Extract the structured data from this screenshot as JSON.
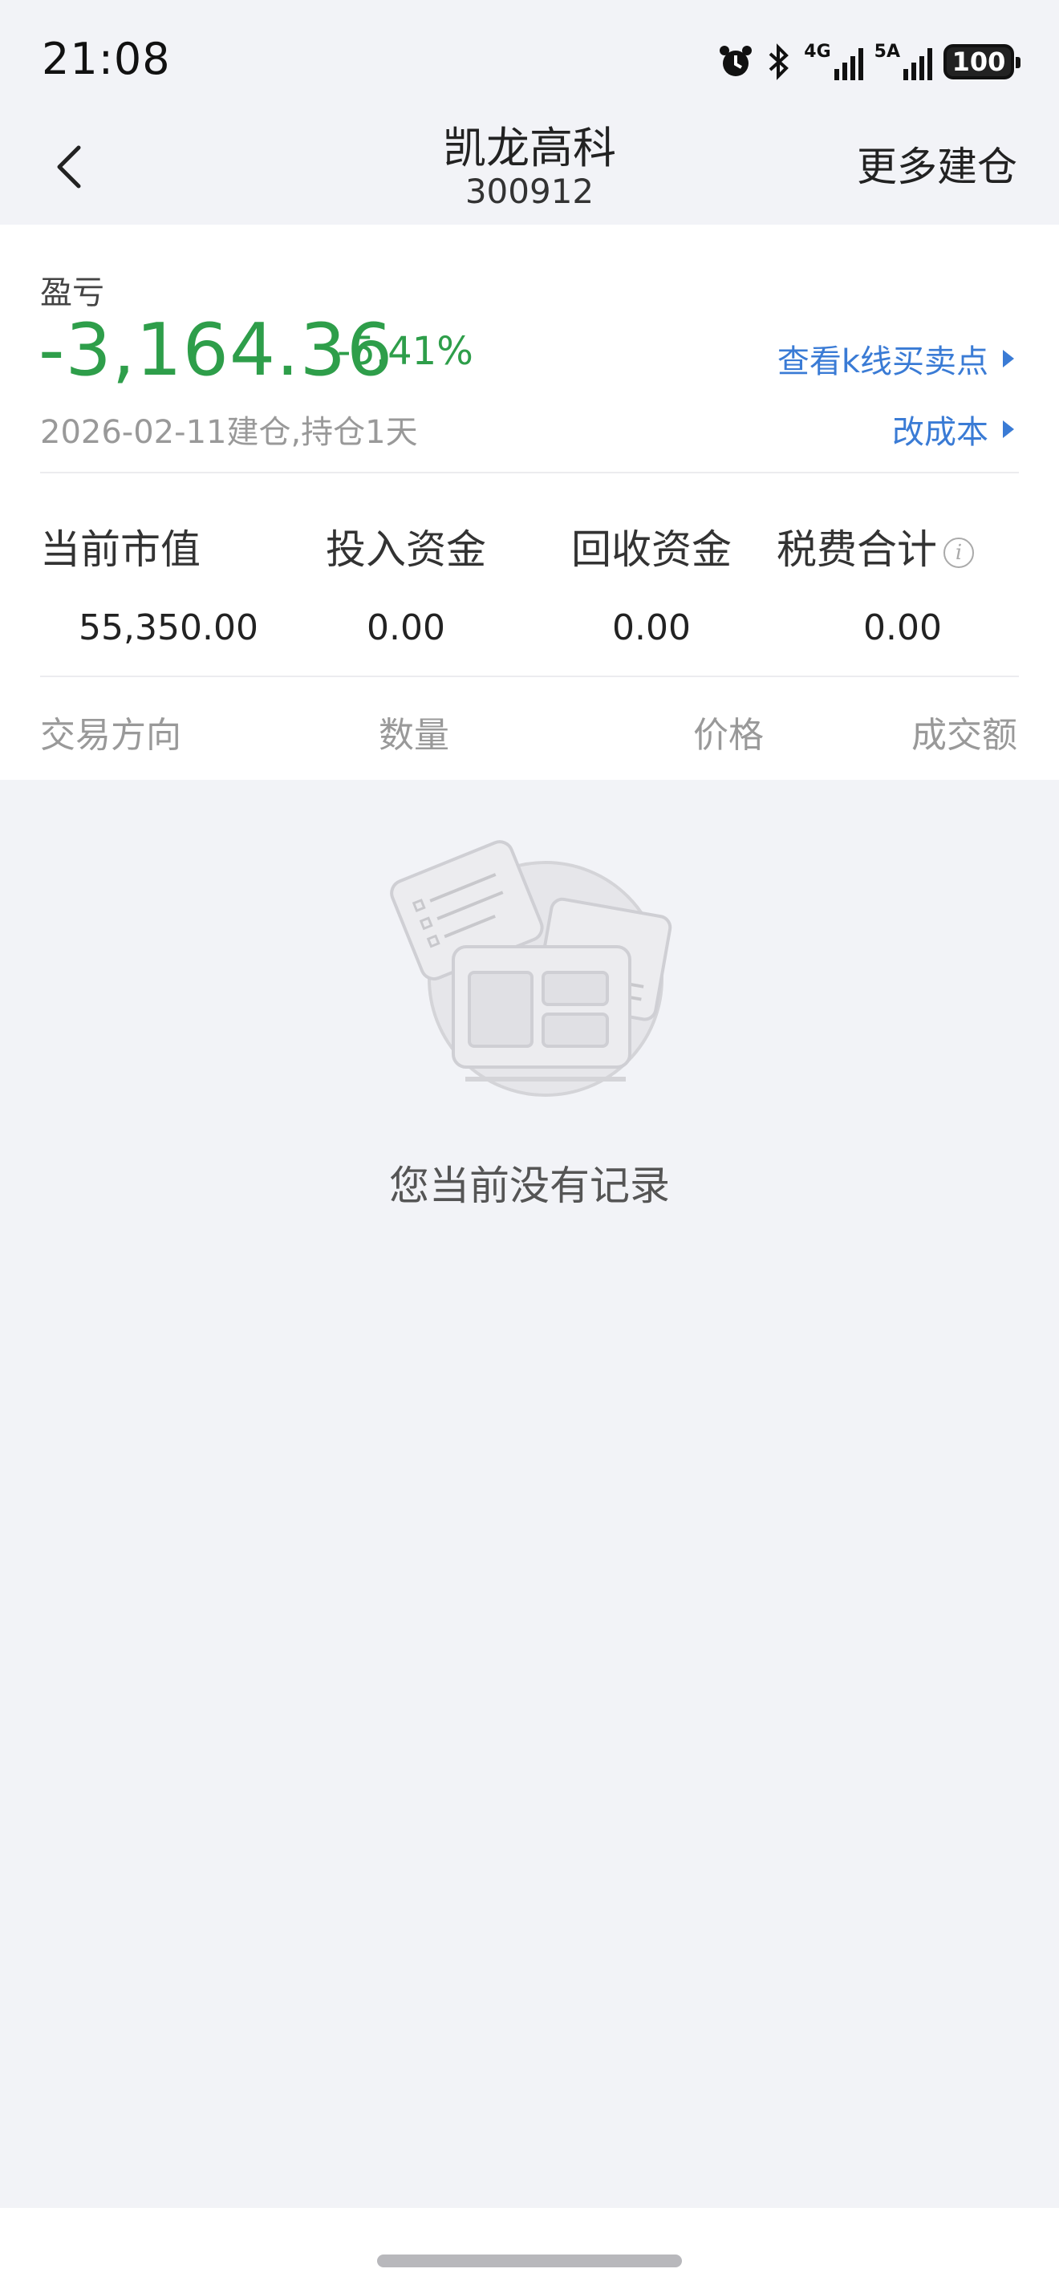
{
  "status_bar": {
    "time": "21:08",
    "icons": [
      "alarm-icon",
      "bluetooth-icon",
      "signal-4g-icon",
      "signal-5a-icon"
    ],
    "net1": "4G",
    "net2": "5A",
    "battery": "100"
  },
  "header": {
    "title": "凯龙高科",
    "code": "300912",
    "more_label": "更多建仓",
    "back_icon": "chevron-left-icon"
  },
  "profit": {
    "label": "盈亏",
    "value": "-3,164.36",
    "percent": "-5.41%",
    "date_info": "2026-02-11建仓,持仓1天",
    "kline_link": "查看k线买卖点",
    "cost_link": "改成本",
    "color": "#2e9e4a"
  },
  "stats": [
    {
      "label": "当前市值",
      "value": "55,350.00"
    },
    {
      "label": "投入资金",
      "value": "0.00"
    },
    {
      "label": "回收资金",
      "value": "0.00"
    },
    {
      "label": "税费合计",
      "value": "0.00"
    }
  ],
  "table_head": {
    "direction": "交易方向",
    "quantity": "数量",
    "price": "价格",
    "amount": "成交额"
  },
  "empty": {
    "text": "您当前没有记录",
    "icon": "empty-records-icon"
  },
  "colors": {
    "background": "#f2f3f7",
    "link": "#3a7bd5",
    "loss": "#2e9e4a"
  }
}
